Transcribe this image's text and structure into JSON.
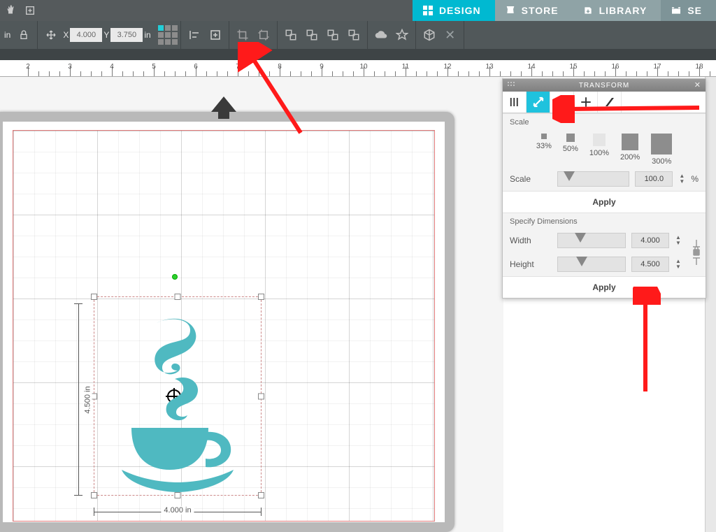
{
  "tabs": {
    "design": "DESIGN",
    "store": "STORE",
    "library": "LIBRARY",
    "send": "SE"
  },
  "options": {
    "x_label": "X",
    "x_value": "4.000",
    "y_label": "Y",
    "y_value": "3.750",
    "unit1": "in",
    "unit2": "in"
  },
  "ruler": {
    "start": 2,
    "end": 18
  },
  "selection": {
    "width_label": "4.000 in",
    "height_label": "4.500 in"
  },
  "panel": {
    "title": "TRANSFORM",
    "sections": {
      "scale": "Scale",
      "dims": "Specify Dimensions"
    },
    "presets": [
      {
        "label": "33%",
        "size": 8
      },
      {
        "label": "50%",
        "size": 12
      },
      {
        "label": "100%",
        "size": 18
      },
      {
        "label": "200%",
        "size": 24
      },
      {
        "label": "300%",
        "size": 30
      }
    ],
    "scale": {
      "label": "Scale",
      "value": "100.0",
      "pct": "%"
    },
    "width": {
      "label": "Width",
      "value": "4.000"
    },
    "height": {
      "label": "Height",
      "value": "4.500"
    },
    "apply": "Apply"
  }
}
